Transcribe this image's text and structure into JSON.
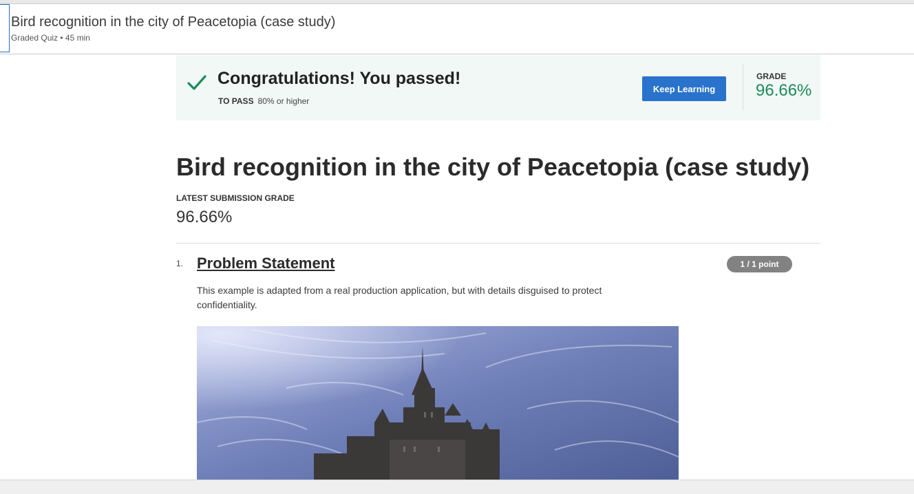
{
  "header": {
    "title": "Bird recognition in the city of Peacetopia (case study)",
    "subtitle": "Graded Quiz • 45 min"
  },
  "banner": {
    "title": "Congratulations! You passed!",
    "pass_label": "TO PASS",
    "pass_value": "80% or higher",
    "button_label": "Keep Learning",
    "grade_label": "GRADE",
    "grade_value": "96.66%",
    "check_icon": "checkmark-icon",
    "accent_color": "#1d8a5a",
    "button_color": "#2a73cc"
  },
  "main": {
    "title": "Bird recognition in the city of Peacetopia (case study)",
    "latest_label": "LATEST SUBMISSION GRADE",
    "latest_value": "96.66%"
  },
  "question": {
    "number": "1.",
    "title": "Problem Statement",
    "points": "1 / 1 point",
    "text": "This example is adapted from a real production application, but with details disguised to protect confidentiality."
  }
}
